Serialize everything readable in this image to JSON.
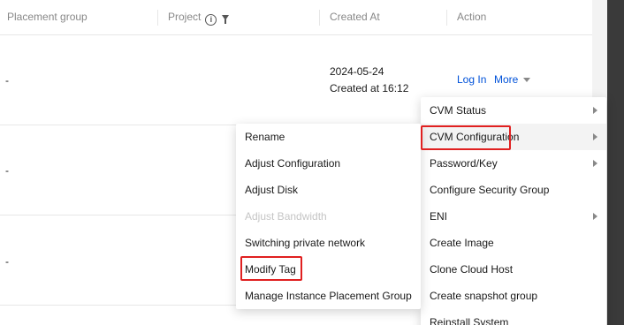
{
  "table": {
    "headers": {
      "placement_group": "Placement group",
      "project": "Project",
      "created_at": "Created At",
      "action": "Action"
    },
    "rows": [
      {
        "placement": "-",
        "created_date": "2024-05-24",
        "created_time": "Created at 16:12",
        "login": "Log In",
        "more": "More"
      },
      {
        "placement": "-"
      },
      {
        "placement": "-"
      }
    ]
  },
  "more_menu": {
    "items": [
      {
        "label": "CVM Status",
        "has_submenu": true
      },
      {
        "label": "CVM Configuration",
        "has_submenu": true,
        "highlighted": true
      },
      {
        "label": "Password/Key",
        "has_submenu": true
      },
      {
        "label": "Configure Security Group",
        "has_submenu": false
      },
      {
        "label": "ENI",
        "has_submenu": true
      },
      {
        "label": "Create Image",
        "has_submenu": false
      },
      {
        "label": "Clone Cloud Host",
        "has_submenu": false
      },
      {
        "label": "Create snapshot group",
        "has_submenu": false
      },
      {
        "label": "Reinstall System",
        "has_submenu": false
      }
    ]
  },
  "config_submenu": {
    "items": [
      {
        "label": "Rename",
        "disabled": false
      },
      {
        "label": "Adjust Configuration",
        "disabled": false
      },
      {
        "label": "Adjust Disk",
        "disabled": false
      },
      {
        "label": "Adjust Bandwidth",
        "disabled": true
      },
      {
        "label": "Switching private network",
        "disabled": false
      },
      {
        "label": "Modify Tag",
        "disabled": false,
        "highlighted": true
      },
      {
        "label": "Manage Instance Placement Group",
        "disabled": false
      }
    ]
  },
  "colors": {
    "link": "#0052d9",
    "highlight_box": "#e02020",
    "disabled_text": "#c5c5c5"
  }
}
